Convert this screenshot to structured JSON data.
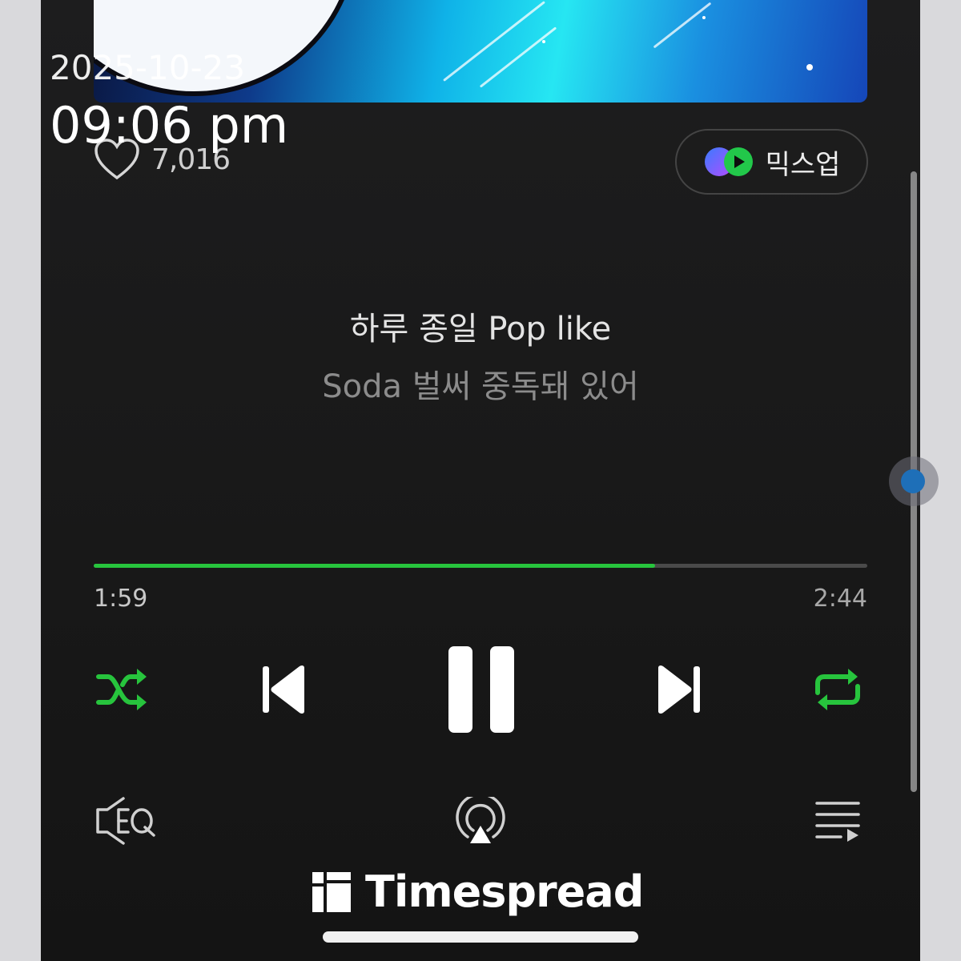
{
  "overlay": {
    "date": "2025-10-23",
    "time": "09:06 pm"
  },
  "player": {
    "like_count": "7,016",
    "mixup_label": "믹스업",
    "lyrics": {
      "current_line": "하루 종일 Pop like",
      "next_line": "Soda 벌써 중독돼 있어"
    },
    "progress": {
      "elapsed": "1:59",
      "duration": "2:44",
      "fraction": 0.7256
    },
    "controls": {
      "shuffle_icon": "shuffle-icon",
      "previous_icon": "previous-icon",
      "play_pause_icon": "pause-icon",
      "next_icon": "next-icon",
      "repeat_icon": "repeat-icon",
      "eq_icon": "eq-icon",
      "airplay_icon": "airplay-icon",
      "playlist_icon": "playlist-icon"
    },
    "colors": {
      "accent": "#27c43d",
      "background": "#181818"
    }
  },
  "watermark": {
    "text": "Timespread"
  }
}
